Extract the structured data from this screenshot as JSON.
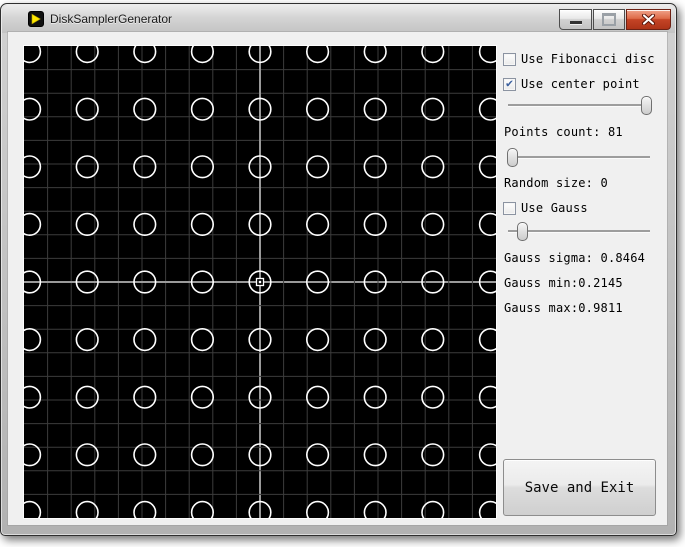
{
  "window": {
    "title": "DiskSamplerGenerator"
  },
  "panel": {
    "checkbox_fibonacci": {
      "label": "Use Fibonacci disc",
      "checked": false,
      "mark": ""
    },
    "checkbox_center": {
      "label": "Use center point",
      "checked": true,
      "mark": "✔"
    },
    "checkbox_gauss": {
      "label": "Use Gauss",
      "checked": false,
      "mark": ""
    },
    "points_count_label": "Points count: 81",
    "random_size_label": "Random size: 0",
    "gauss_sigma_label": "Gauss sigma: 0.8464",
    "gauss_min_label": "Gauss min:0.2145",
    "gauss_max_label": "Gauss max:0.9811",
    "save_button_label": "Save and Exit",
    "sliders": [
      {
        "name": "points-count-slider",
        "pos": 0.97
      },
      {
        "name": "random-size-slider",
        "pos": 0.03
      },
      {
        "name": "gauss-sigma-slider",
        "pos": 0.1
      }
    ]
  },
  "canvas": {
    "background": "#000000",
    "grid_color": "#3c3c3c",
    "axis_color": "#9a9a9a",
    "point_color": "#ffffff",
    "size": 472,
    "grid_divisions": 20,
    "points_rows": 9,
    "points_cols": 9,
    "point_spacing": 57.6,
    "point_radius": 10.8,
    "center_marker": true
  }
}
